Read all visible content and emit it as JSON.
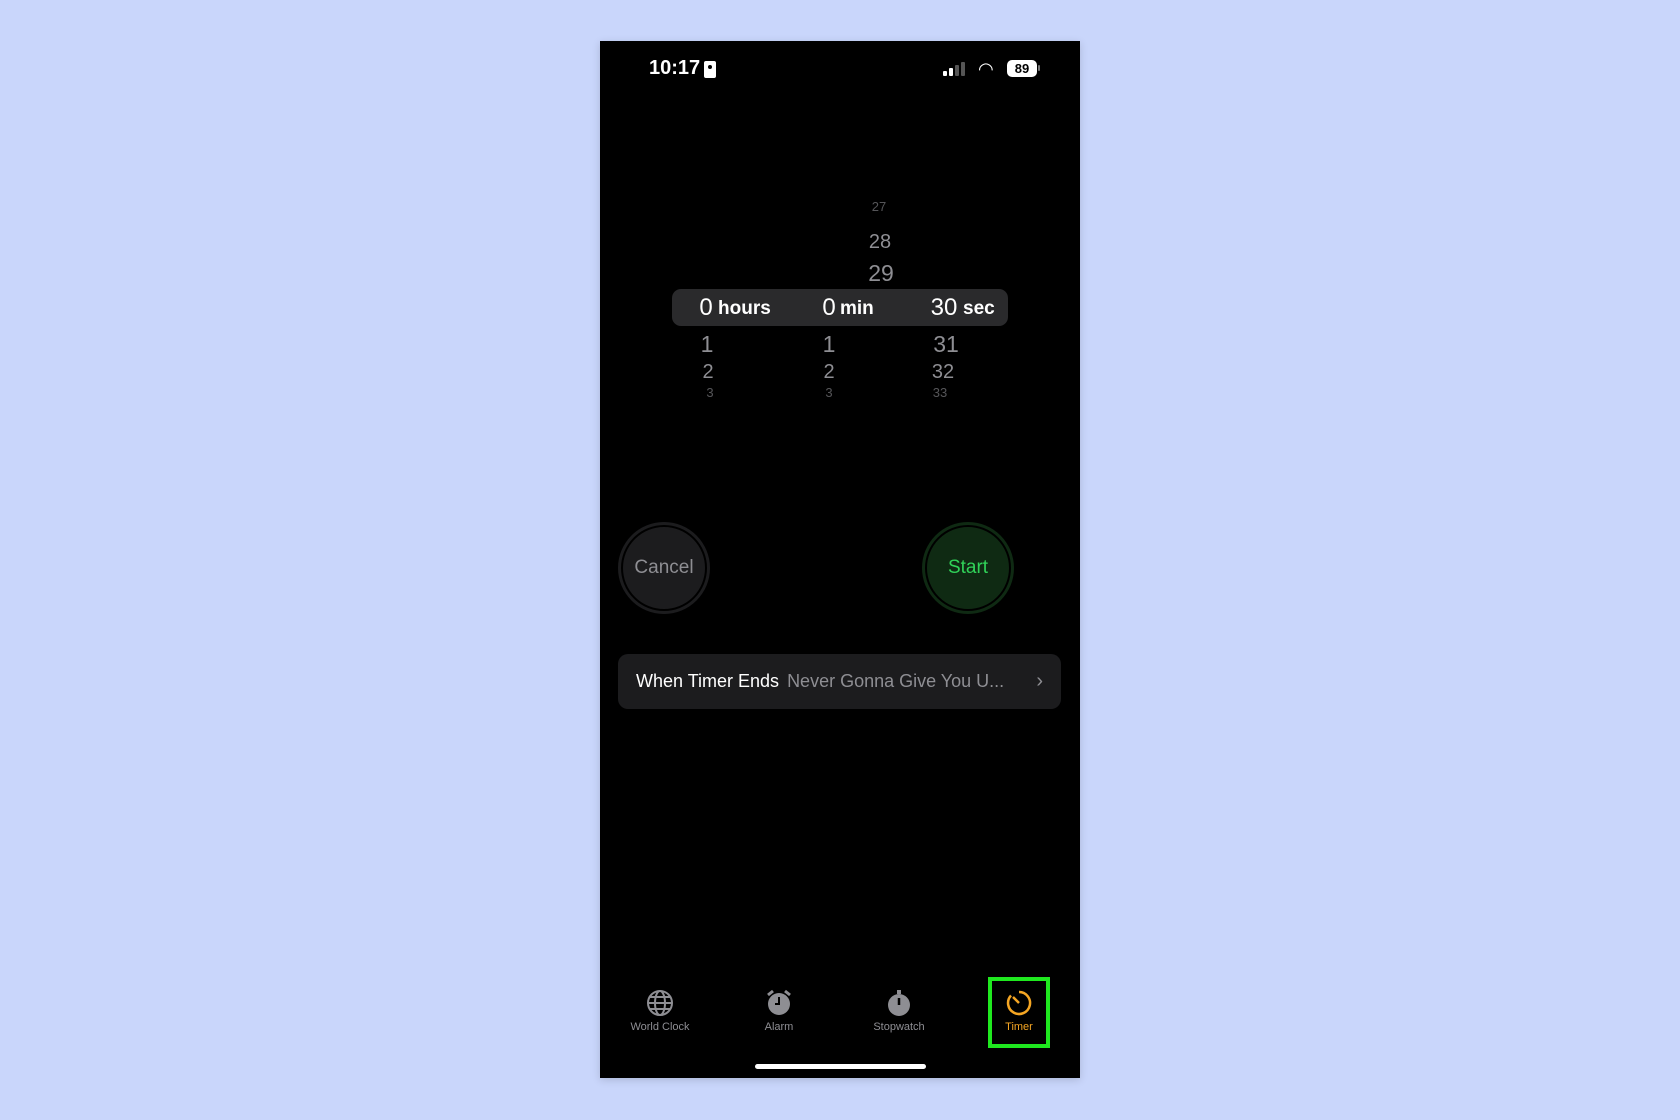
{
  "status": {
    "time": "10:17",
    "battery": "89"
  },
  "picker": {
    "hours": {
      "above": [],
      "selected": "0",
      "unit": "hours",
      "below": [
        "1",
        "2",
        "3"
      ]
    },
    "minutes": {
      "above": [],
      "selected": "0",
      "unit": "min",
      "below": [
        "1",
        "2",
        "3"
      ]
    },
    "seconds": {
      "above": [
        "27",
        "28",
        "29"
      ],
      "selected": "30",
      "unit": "sec",
      "below": [
        "31",
        "32",
        "33"
      ]
    }
  },
  "buttons": {
    "cancel": "Cancel",
    "start": "Start"
  },
  "timer_ends": {
    "label": "When Timer Ends",
    "value": "Never Gonna Give You U..."
  },
  "tabs": [
    {
      "label": "World Clock",
      "icon": "globe-icon"
    },
    {
      "label": "Alarm",
      "icon": "alarm-clock-icon"
    },
    {
      "label": "Stopwatch",
      "icon": "stopwatch-icon"
    },
    {
      "label": "Timer",
      "icon": "timer-icon",
      "active": true
    }
  ],
  "colors": {
    "active_tab": "#f5a623",
    "start": "#30d158",
    "highlight_box": "#1fe81f"
  }
}
